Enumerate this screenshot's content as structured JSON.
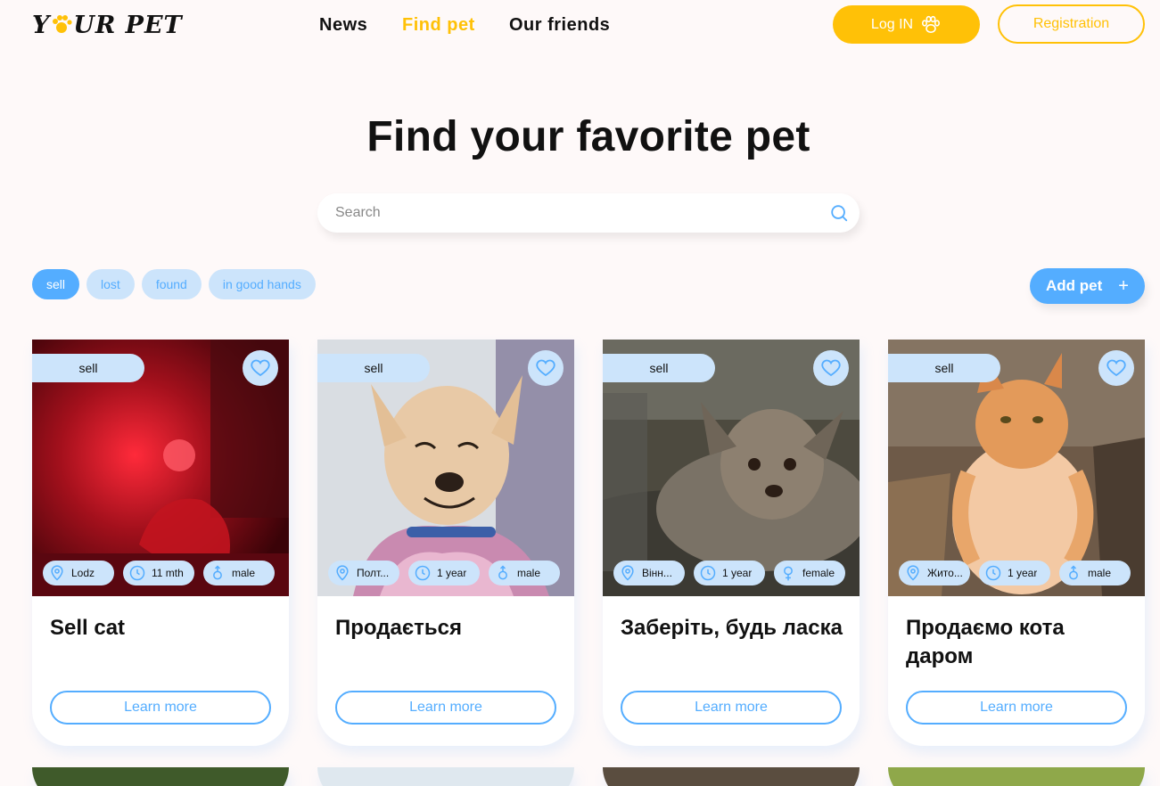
{
  "header": {
    "logo_text_left": "Y",
    "logo_text_right": "UR PET",
    "nav": [
      {
        "label": "News",
        "active": false
      },
      {
        "label": "Find pet",
        "active": true
      },
      {
        "label": "Our friends",
        "active": false
      }
    ],
    "login_label": "Log IN",
    "register_label": "Registration"
  },
  "main": {
    "title": "Find your favorite pet",
    "search_placeholder": "Search",
    "filters": [
      {
        "label": "sell",
        "active": true
      },
      {
        "label": "lost",
        "active": false
      },
      {
        "label": "found",
        "active": false
      },
      {
        "label": "in good hands",
        "active": false
      }
    ],
    "add_pet_label": "Add pet",
    "add_pet_icon": "plus-icon",
    "cards": [
      {
        "category": "sell",
        "location": "Lodz",
        "age": "11 mth",
        "sex": "male",
        "title": "Sell cat",
        "learn_more": "Learn more"
      },
      {
        "category": "sell",
        "location": "Полт...",
        "age": "1 year",
        "sex": "male",
        "title": "Продається",
        "learn_more": "Learn more"
      },
      {
        "category": "sell",
        "location": "Вінн...",
        "age": "1 year",
        "sex": "female",
        "title": "Заберіть, будь ласка",
        "learn_more": "Learn more"
      },
      {
        "category": "sell",
        "location": "Жито...",
        "age": "1 year",
        "sex": "male",
        "title": "Продаємо кота даром",
        "learn_more": "Learn more"
      }
    ]
  },
  "colors": {
    "accent_yellow": "#ffc107",
    "accent_blue": "#54adff",
    "light_blue": "#cce4fb",
    "background": "#fef9f9"
  }
}
